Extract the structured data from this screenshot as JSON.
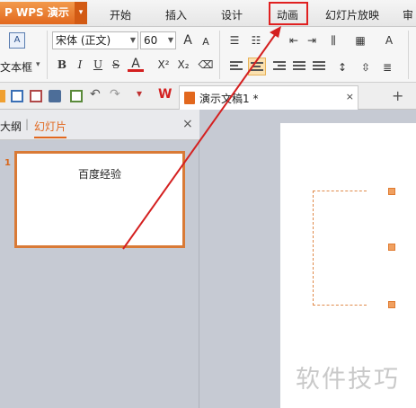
{
  "app": {
    "logo_text": "P WPS 演示",
    "menu_caret": "▾"
  },
  "tabs": [
    {
      "label": "开始"
    },
    {
      "label": "插入"
    },
    {
      "label": "设计"
    },
    {
      "label": "动画"
    },
    {
      "label": "幻灯片放映"
    },
    {
      "label": "审"
    }
  ],
  "ribbon": {
    "textbox_label": "文本框",
    "textbox_caret": "▾",
    "font_name": "宋体 (正文)",
    "font_size": "60",
    "grow_font": "A",
    "shrink_font": "A",
    "bold": "B",
    "italic": "I",
    "underline": "U",
    "strike": "S",
    "font_color": "A",
    "superscript": "X²",
    "subscript": "X₂"
  },
  "quick_access": {
    "doc_tab_label": "演示文稿1 *",
    "doc_tab_close": "×",
    "new_tab": "+"
  },
  "left_pane": {
    "outline_tab": "大纲",
    "slides_tab": "幻灯片",
    "close": "×",
    "slide_number": "1",
    "slide_title": "百度经验"
  },
  "watermark": "软件技巧",
  "colors": {
    "accent_orange": "#e2681e",
    "highlight_red": "#e02020",
    "arrow_red": "#d42020"
  }
}
